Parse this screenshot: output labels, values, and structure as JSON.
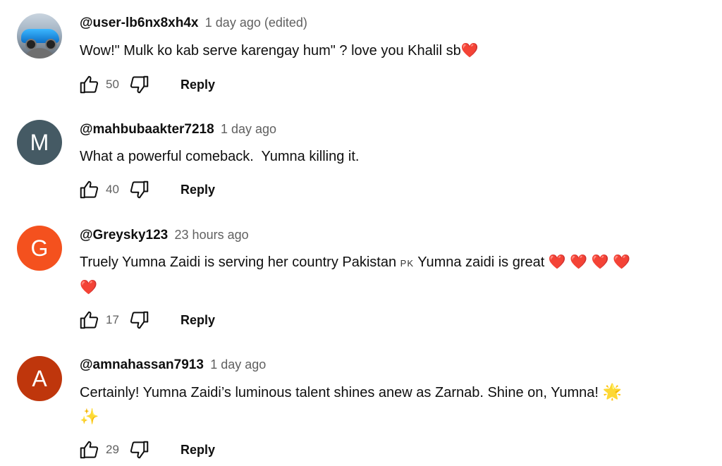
{
  "comments": [
    {
      "avatar": {
        "type": "image",
        "icon": "car-avatar-icon"
      },
      "handle": "@user-lb6nx8xh4x",
      "time": "1 day ago (edited)",
      "text": "Wow!\" Mulk ko kab serve karengay hum\" ? love you Khalil sb",
      "emoji": "❤️",
      "likes": "50",
      "reply_label": "Reply"
    },
    {
      "avatar": {
        "type": "letter",
        "letter": "M",
        "color": "#455a64"
      },
      "handle": "@mahbubaakter7218",
      "time": "1 day ago",
      "text": "What a powerful comeback.  Yumna killing it.",
      "likes": "40",
      "reply_label": "Reply"
    },
    {
      "avatar": {
        "type": "letter",
        "letter": "G",
        "color": "#f4511e"
      },
      "handle": "@Greysky123",
      "time": "23 hours ago",
      "text_a": "Truely Yumna Zaidi is serving her country Pakistan",
      "flag": "PK",
      "text_b": "Yumna zaidi is great",
      "hearts_line1": "❤️ ❤️ ❤️ ❤️",
      "hearts_line2": "❤️",
      "likes": "17",
      "reply_label": "Reply"
    },
    {
      "avatar": {
        "type": "letter",
        "letter": "A",
        "color": "#bf360c"
      },
      "handle": "@amnahassan7913",
      "time": "1 day ago",
      "text": "Certainly! Yumna Zaidi’s luminous talent shines anew as Zarnab. Shine on, Yumna!",
      "emoji_1": "🌟",
      "emoji_2": "✨",
      "likes": "29",
      "reply_label": "Reply"
    }
  ],
  "icons": {
    "like": "thumb-up-icon",
    "dislike": "thumb-down-icon"
  }
}
